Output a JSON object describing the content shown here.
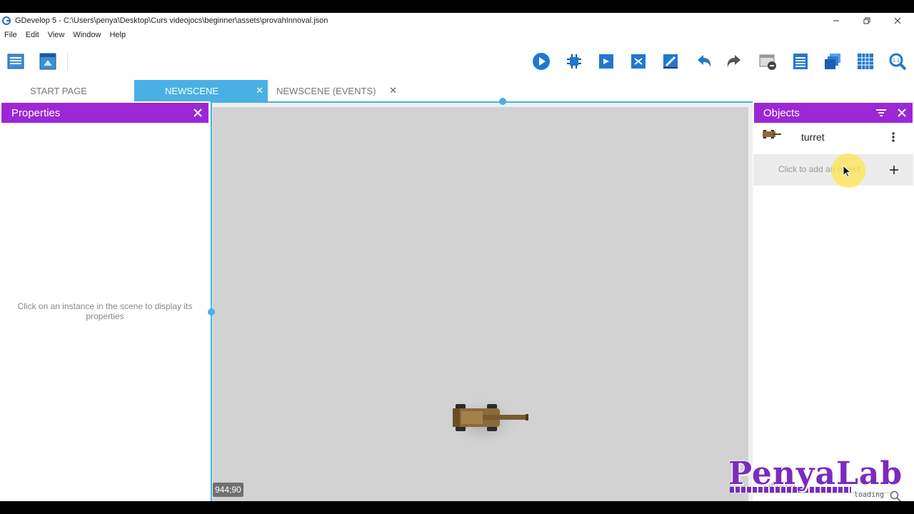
{
  "window": {
    "title": "GDevelop 5 - C:\\Users\\penya\\Desktop\\Curs videojocs\\beginner\\assets\\provahInnoval.json"
  },
  "menu": [
    "File",
    "Edit",
    "View",
    "Window",
    "Help"
  ],
  "toolbar": {
    "icons": [
      "project-manager-icon",
      "scene-window-icon",
      "preview-icon",
      "debugger-icon",
      "add-instance-icon",
      "object-groups-icon",
      "edit-icon",
      "undo-icon",
      "redo-icon",
      "delete-icon",
      "instances-list-icon",
      "layers-icon",
      "grid-icon",
      "zoom-icon"
    ]
  },
  "tabs": [
    {
      "label": "START PAGE",
      "active": false
    },
    {
      "label": "NEWSCENE",
      "active": true
    },
    {
      "label": "NEWSCENE (EVENTS)",
      "active": false
    }
  ],
  "properties": {
    "title": "Properties",
    "hint": "Click on an instance in the scene to display its properties"
  },
  "scene": {
    "coordinates": "944;90"
  },
  "objects": {
    "title": "Objects",
    "items": [
      {
        "name": "turret",
        "icon": "turret-sprite-icon"
      }
    ],
    "add_hint": "Click to add an object",
    "search_placeholder": "Search"
  },
  "watermark": {
    "text": "PenyaLab",
    "subtext": "loading ..."
  },
  "colors": {
    "accent_blue": "#4ab0e4",
    "panel_purple": "#9c27d4",
    "scene_gray": "#d2d2d2"
  }
}
